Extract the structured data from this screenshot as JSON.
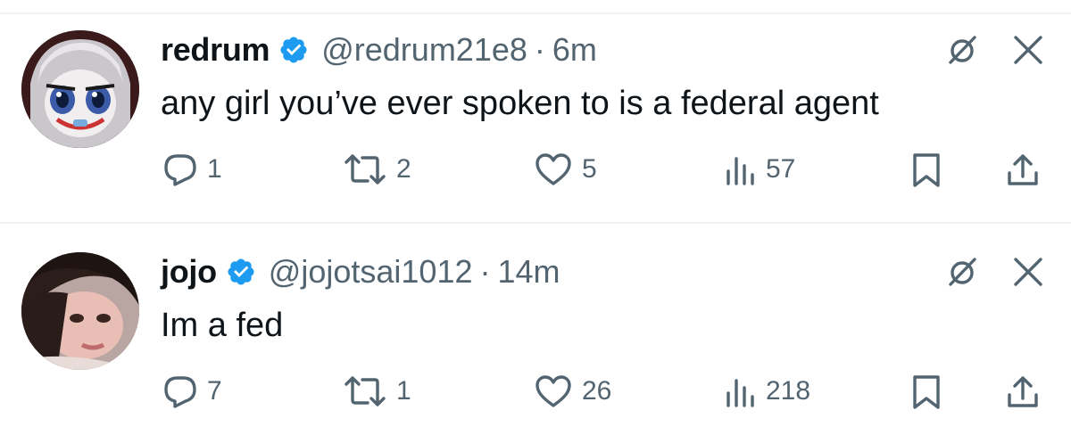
{
  "accent_colors": {
    "verified": "#1d9bf0",
    "secondary_text": "#536471",
    "divider": "#eff3f4"
  },
  "tweets": [
    {
      "display_name": "redrum",
      "handle": "@redrum21e8",
      "separator": "·",
      "time": "6m",
      "text": "any girl you’ve ever spoken to is a federal agent",
      "verified": true,
      "metrics": {
        "replies": "1",
        "reposts": "2",
        "likes": "5",
        "views": "57"
      },
      "icons": [
        "grok-slash-icon",
        "close-icon",
        "reply-icon",
        "repost-icon",
        "like-icon",
        "views-icon",
        "bookmark-icon",
        "share-icon"
      ]
    },
    {
      "display_name": "jojo",
      "handle": "@jojotsai1012",
      "separator": "·",
      "time": "14m",
      "text": "Im a fed",
      "verified": true,
      "metrics": {
        "replies": "7",
        "reposts": "1",
        "likes": "26",
        "views": "218"
      },
      "icons": [
        "grok-slash-icon",
        "close-icon",
        "reply-icon",
        "repost-icon",
        "like-icon",
        "views-icon",
        "bookmark-icon",
        "share-icon"
      ]
    }
  ]
}
